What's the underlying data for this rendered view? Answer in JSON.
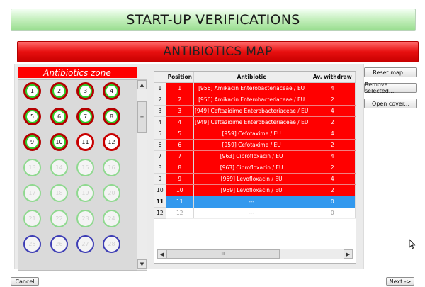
{
  "header": {
    "title": "START-UP VERIFICATIONS"
  },
  "map": {
    "title": "ANTIBIOTICS MAP"
  },
  "zone": {
    "title": "Antibiotics zone",
    "circles": [
      {
        "label": "1",
        "state": "used"
      },
      {
        "label": "2",
        "state": "used"
      },
      {
        "label": "3",
        "state": "used"
      },
      {
        "label": "4",
        "state": "used"
      },
      {
        "label": "5",
        "state": "used"
      },
      {
        "label": "6",
        "state": "used"
      },
      {
        "label": "7",
        "state": "used"
      },
      {
        "label": "8",
        "state": "used"
      },
      {
        "label": "9",
        "state": "used"
      },
      {
        "label": "10",
        "state": "used"
      },
      {
        "label": "11",
        "state": "selected"
      },
      {
        "label": "12",
        "state": "selected"
      },
      {
        "label": "13",
        "state": "free"
      },
      {
        "label": "14",
        "state": "free"
      },
      {
        "label": "15",
        "state": "free"
      },
      {
        "label": "16",
        "state": "free"
      },
      {
        "label": "17",
        "state": "free"
      },
      {
        "label": "18",
        "state": "free"
      },
      {
        "label": "19",
        "state": "free"
      },
      {
        "label": "20",
        "state": "free"
      },
      {
        "label": "21",
        "state": "free"
      },
      {
        "label": "22",
        "state": "free"
      },
      {
        "label": "23",
        "state": "free"
      },
      {
        "label": "24",
        "state": "free"
      },
      {
        "label": "25",
        "state": "blue"
      },
      {
        "label": "26",
        "state": "blue"
      },
      {
        "label": "27",
        "state": "blue"
      },
      {
        "label": "28",
        "state": "blue"
      }
    ]
  },
  "table": {
    "headers": [
      "",
      "Position",
      "Antibiotic",
      "Av. withdraw"
    ],
    "rows": [
      {
        "row": "1",
        "position": "1",
        "antibiotic": "[956] Amikacin Enterobacteriaceae / EU",
        "withdraw": "4",
        "state": "red"
      },
      {
        "row": "2",
        "position": "2",
        "antibiotic": "[956] Amikacin Enterobacteriaceae / EU",
        "withdraw": "2",
        "state": "red"
      },
      {
        "row": "3",
        "position": "3",
        "antibiotic": "[949] Ceftazidime Enterobacteriaceae / EU",
        "withdraw": "4",
        "state": "red"
      },
      {
        "row": "4",
        "position": "4",
        "antibiotic": "[949] Ceftazidime Enterobacteriaceae / EU",
        "withdraw": "2",
        "state": "red"
      },
      {
        "row": "5",
        "position": "5",
        "antibiotic": "[959] Cefotaxime / EU",
        "withdraw": "4",
        "state": "red"
      },
      {
        "row": "6",
        "position": "6",
        "antibiotic": "[959] Cefotaxime / EU",
        "withdraw": "2",
        "state": "red"
      },
      {
        "row": "7",
        "position": "7",
        "antibiotic": "[963] Ciprofloxacin / EU",
        "withdraw": "4",
        "state": "red"
      },
      {
        "row": "8",
        "position": "8",
        "antibiotic": "[963] Ciprofloxacin / EU",
        "withdraw": "2",
        "state": "red"
      },
      {
        "row": "9",
        "position": "9",
        "antibiotic": "[969] Levofloxacin / EU",
        "withdraw": "4",
        "state": "red"
      },
      {
        "row": "10",
        "position": "10",
        "antibiotic": "[969] Levofloxacin / EU",
        "withdraw": "2",
        "state": "red"
      },
      {
        "row": "11",
        "position": "11",
        "antibiotic": "---",
        "withdraw": "0",
        "state": "sel"
      },
      {
        "row": "12",
        "position": "12",
        "antibiotic": "---",
        "withdraw": "0",
        "state": "empty"
      }
    ]
  },
  "buttons": {
    "reset": "Reset map...",
    "remove": "Remove selected...",
    "open_cover": "Open cover...",
    "cancel": "Cancel",
    "next": "Next ->"
  },
  "scroll": {
    "h_thumb": "III",
    "v_thumb": "≡"
  },
  "colors": {
    "used_fill": "#2fd12f",
    "used_ring": "#b40000",
    "row_red": "#ff0000",
    "row_selected": "#3399ee"
  }
}
